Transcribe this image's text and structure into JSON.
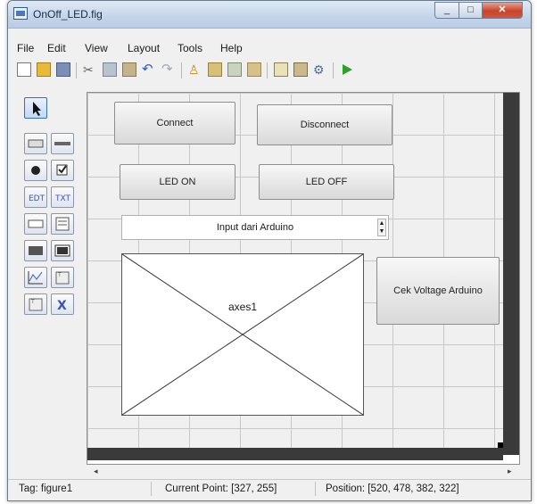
{
  "window": {
    "title": "OnOff_LED.fig"
  },
  "menu": [
    "File",
    "Edit",
    "View",
    "Layout",
    "Tools",
    "Help"
  ],
  "toolbar_icons": [
    "new-file-icon",
    "open-folder-icon",
    "save-icon",
    "cut-icon",
    "copy-icon",
    "paste-icon",
    "undo-icon",
    "redo-icon",
    "align-icon",
    "menu-editor-icon",
    "tab-order-icon",
    "toolbar-editor-icon",
    "mfile-editor-icon",
    "property-inspector-icon",
    "object-browser-icon",
    "run-icon"
  ],
  "palette_icons": [
    "select-arrow-icon",
    "push-button-icon",
    "slider-icon",
    "radio-button-icon",
    "checkbox-icon",
    "edit-text-icon",
    "static-text-icon",
    "popup-menu-icon",
    "listbox-icon",
    "toggle-button-icon",
    "table-icon",
    "axes-icon",
    "panel-icon",
    "button-group-icon",
    "activex-icon"
  ],
  "components": {
    "connect": "Connect",
    "disconnect": "Disconnect",
    "led_on": "LED ON",
    "led_off": "LED OFF",
    "popup": "Input dari Arduino",
    "axes": "axes1",
    "cek_voltage": "Cek Voltage Arduino"
  },
  "status": {
    "tag": "Tag: figure1",
    "current_point": "Current Point:  [327, 255]",
    "position": "Position: [520, 478, 382, 322]"
  },
  "colors": {
    "accent": "#2e9e2e",
    "title_gradient": "#c4d5ea",
    "close": "#c9442c"
  }
}
